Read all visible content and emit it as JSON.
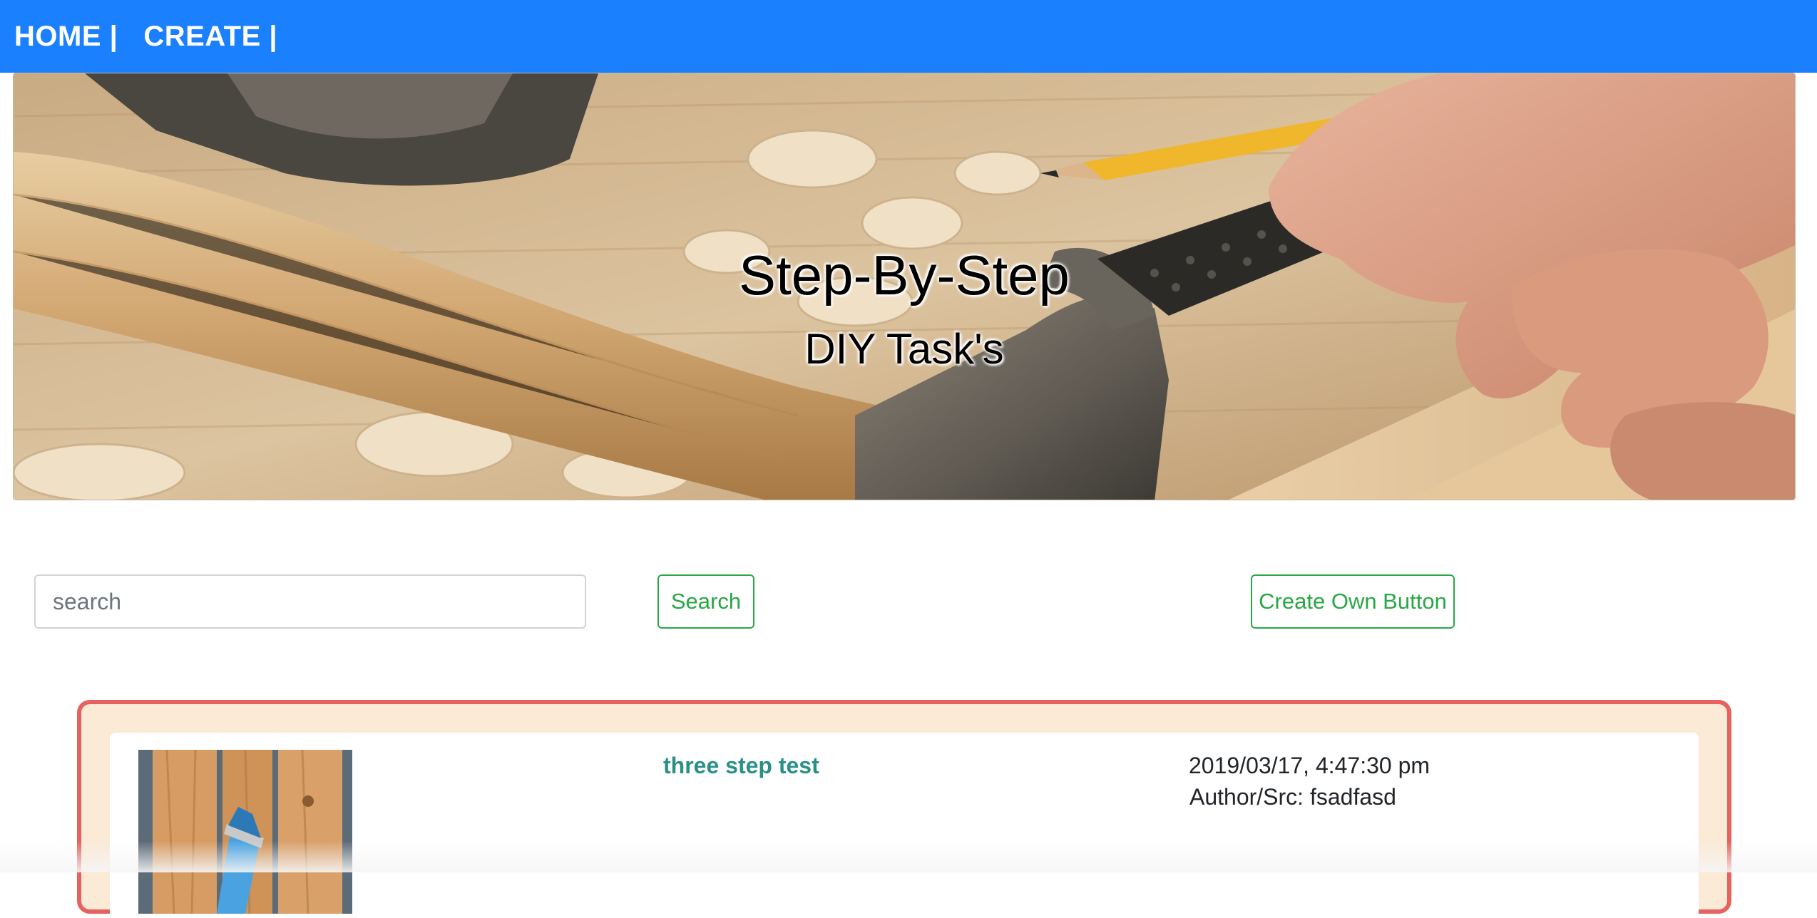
{
  "nav": {
    "items": [
      {
        "label": "HOME |"
      },
      {
        "label": "CREATE |"
      }
    ]
  },
  "hero": {
    "title": "Step-By-Step",
    "subtitle": "DIY Task's"
  },
  "search": {
    "placeholder": "search",
    "button_label": "Search"
  },
  "create_button_label": "Create Own Button",
  "tasks": [
    {
      "title": "three step test",
      "date": "2019/03/17, 4:47:30 pm",
      "author": "Author/Src: fsadfasd"
    }
  ],
  "colors": {
    "navbar": "#1a80fe",
    "accent_green": "#28a745",
    "card_border": "#e5625e",
    "card_background": "#fbead6",
    "task_title": "#2a9086"
  }
}
